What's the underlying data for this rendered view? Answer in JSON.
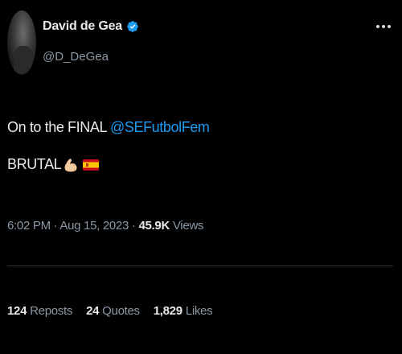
{
  "author": {
    "display_name": "David de Gea",
    "handle": "@D_DeGea",
    "verified_icon": "verified-badge-icon",
    "verified_color": "#1d9bf0"
  },
  "tweet": {
    "line1_prefix": "On to the FINAL ",
    "line1_mention": "@SEFutbolFem",
    "line2_text": "BRUTAL",
    "line2_emojis": [
      "flexed-biceps-emoji",
      "spain-flag-emoji"
    ]
  },
  "meta": {
    "time": "6:02 PM",
    "separator": " · ",
    "date": "Aug 15, 2023",
    "views_count": "45.9K",
    "views_label": "Views"
  },
  "stats": [
    {
      "count": "124",
      "label": "Reposts"
    },
    {
      "count": "24",
      "label": "Quotes"
    },
    {
      "count": "1,829",
      "label": "Likes"
    }
  ],
  "colors": {
    "background": "#000000",
    "text": "#e7e9ea",
    "muted": "#8b98a5",
    "link": "#1d9bf0",
    "divider": "#2f3336"
  }
}
